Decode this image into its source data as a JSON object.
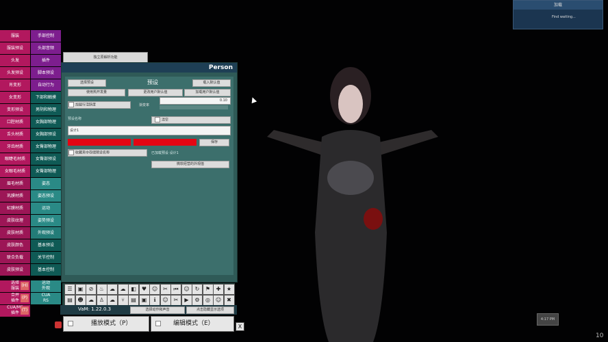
{
  "left_menu": {
    "col1": [
      "服装",
      "服装预设",
      "头发",
      "头发预设",
      "肖变形",
      "女变形",
      "变形预设",
      "口腔材质",
      "舌头材质",
      "牙齿材质",
      "眼睫毛材质",
      "女眼毛材质",
      "眉毛材质",
      "巩膜材质",
      "虹膜材质",
      "皮肤纹理",
      "皮肤材质",
      "皮肤颜色",
      "联合负载",
      "皮肤预设"
    ],
    "col2": [
      "手部控制",
      "头部音频",
      "插件",
      "脚本预设",
      "自动行为",
      "下部和触摸",
      "男阴和物理",
      "女胸部物理",
      "女胸部预设",
      "女臀部物理",
      "女臀部预设",
      "女臀部物理",
      "姿态",
      "姿态预设",
      "运动",
      "姿势预设",
      "外观预设",
      "基本预设",
      "关节控制",
      "基本控制"
    ],
    "extra": [
      {
        "label": "选择\n服装",
        "tag": "(H)",
        "side": "运动\n外观"
      },
      {
        "label": "合并\n插件",
        "tag": "(P)",
        "side": "CUA\nRS"
      },
      {
        "label": "CUA/MS\n插件",
        "tag": "(T)",
        "side": ""
      }
    ]
  },
  "tab_above": "独立原解析功能",
  "panel": {
    "title": "Person",
    "section_title": "预设",
    "select_btn": "选择预设",
    "load_default_btn": "载入默认值",
    "use_hotkey": "使用热开发量",
    "save_user_btn": "更改用户默认值",
    "load_user_btn": "加载用户默认值",
    "checkbox_label": "加载行活跃度",
    "slider_label": "渐变率",
    "slider_value": "0.10",
    "name_label": "预设名称",
    "clear_btn": "清空",
    "name_value": "设计1",
    "save_btn": "保存",
    "favorite": "收藏夹中存储预设名称",
    "saved_label": "已加载预设 设计1",
    "extra_btn": "微软经营的外观值"
  },
  "bottom": {
    "version": "VaM: 1.22.0.3",
    "select_action": "选择动作和声音",
    "hide_btn": "点击隐藏显示选项",
    "play_mode": "播放模式（P）",
    "edit_mode": "编辑模式（E）",
    "close": "X"
  },
  "toolbar_icons": [
    "list-icon",
    "image-icon",
    "no-image-icon",
    "fire-icon",
    "cloud-icon",
    "cloud2-icon",
    "bag-icon",
    "heart-icon",
    "person-icon",
    "shoe-icon",
    "prev-icon",
    "person2-icon",
    "rotate-icon",
    "flag-icon",
    "plus-icon",
    "star-icon",
    "doc-icon",
    "face-icon",
    "cloud3-icon",
    "pose-icon",
    "cloud4-icon",
    "branch-icon",
    "doc2-icon",
    "image2-icon",
    "info-icon",
    "person3-icon",
    "shoe2-icon",
    "play-icon",
    "gear-icon",
    "globe-icon",
    "person4-icon",
    "tools-icon"
  ],
  "notification": {
    "title": "加载",
    "body": "Find waiting..."
  },
  "timer": "4:17 PM",
  "corner_number": "10"
}
